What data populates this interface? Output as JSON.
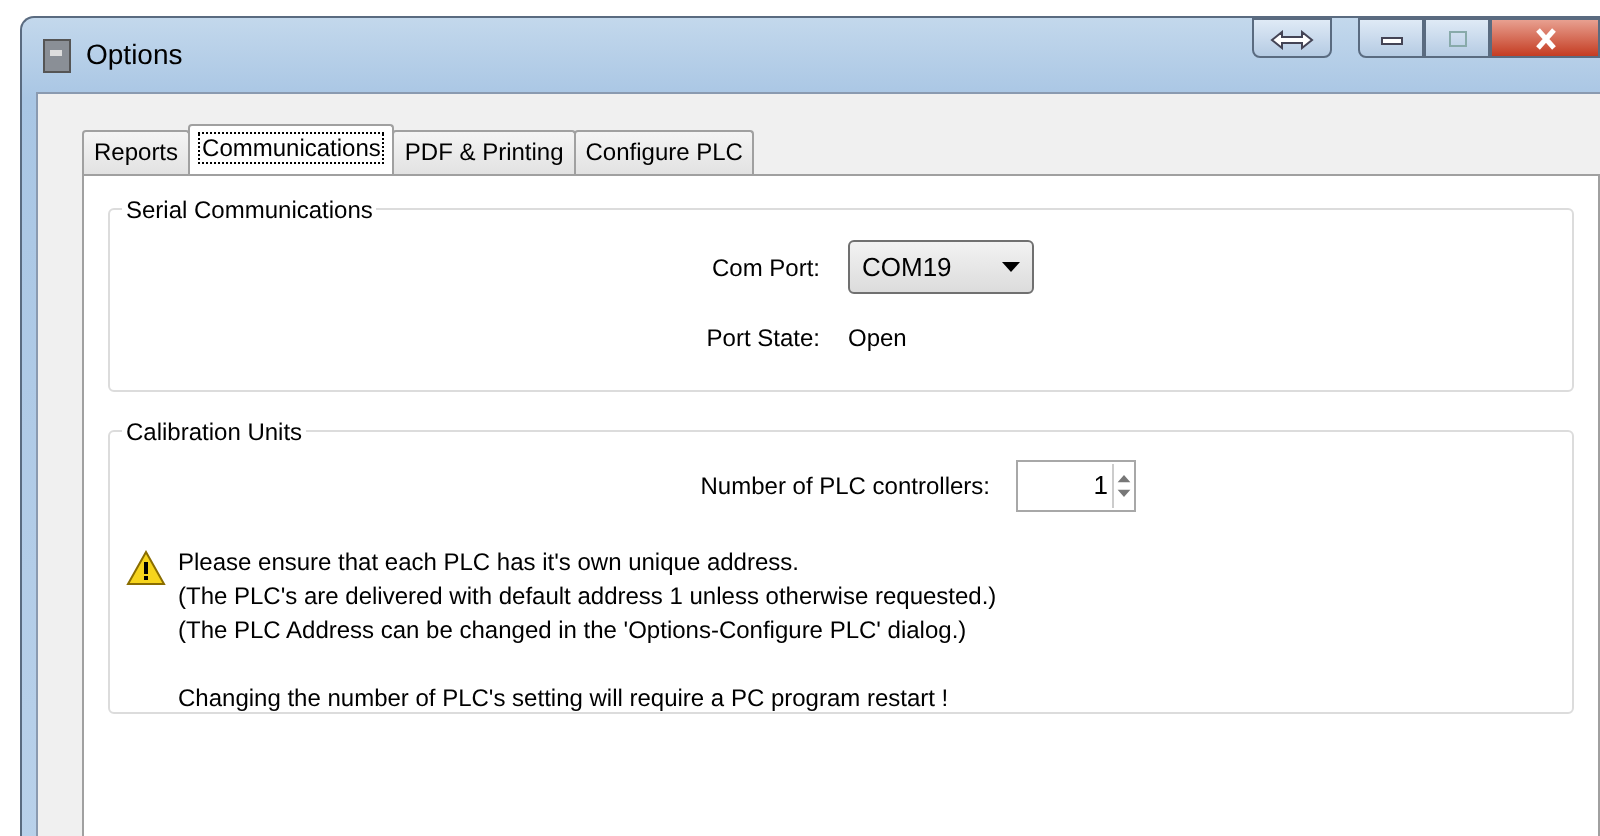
{
  "window": {
    "title": "Options"
  },
  "tabs": [
    {
      "label": "Reports",
      "selected": false
    },
    {
      "label": "Communications",
      "selected": true
    },
    {
      "label": "PDF & Printing",
      "selected": false
    },
    {
      "label": "Configure PLC",
      "selected": false
    }
  ],
  "serial_communications": {
    "title": "Serial Communications",
    "com_port_label": "Com Port:",
    "com_port_value": "COM19",
    "port_state_label": "Port State:",
    "port_state_value": "Open"
  },
  "calibration_units": {
    "title": "Calibration Units",
    "controllers_label": "Number of PLC controllers:",
    "controllers_value": "1",
    "notice_lines": [
      "Please ensure that each PLC has it's own unique address.",
      "(The PLC's are delivered with default address 1 unless otherwise requested.)",
      "(The PLC Address can be changed in the 'Options-Configure PLC' dialog.)"
    ],
    "restart_note": "Changing the number of PLC's setting will require a PC program restart !"
  }
}
